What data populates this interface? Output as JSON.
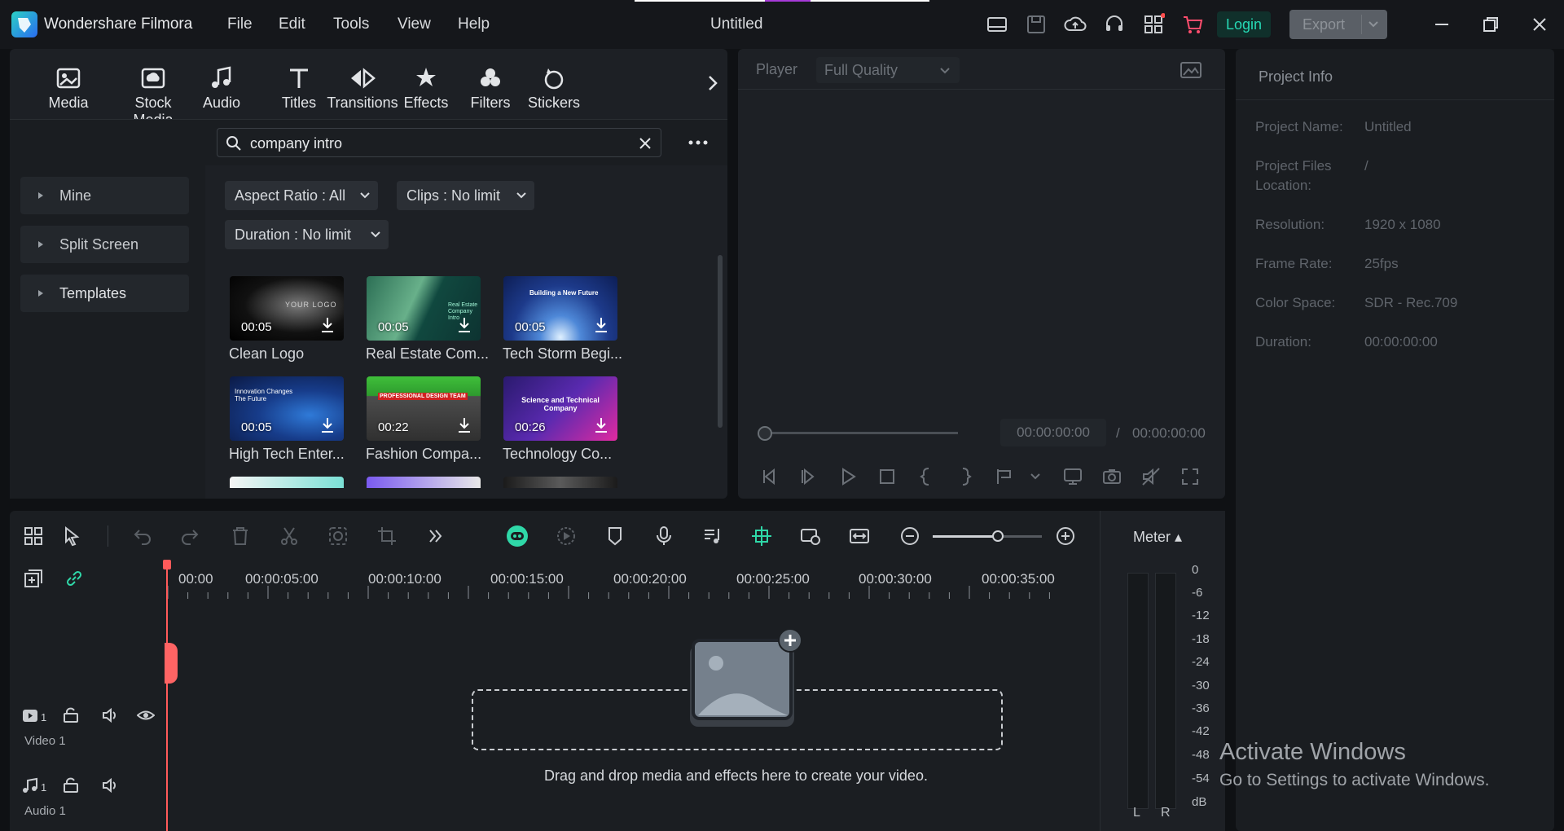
{
  "app": {
    "name": "Wondershare Filmora",
    "doc_title": "Untitled",
    "menu": [
      "File",
      "Edit",
      "Tools",
      "View",
      "Help"
    ],
    "login_label": "Login",
    "export_label": "Export",
    "accent": "#26d9b5"
  },
  "categories": [
    {
      "label": "Media",
      "icon": "media-icon"
    },
    {
      "label": "Stock Media",
      "icon": "stock-media-icon"
    },
    {
      "label": "Audio",
      "icon": "audio-icon"
    },
    {
      "label": "Titles",
      "icon": "titles-icon"
    },
    {
      "label": "Transitions",
      "icon": "transitions-icon"
    },
    {
      "label": "Effects",
      "icon": "effects-icon"
    },
    {
      "label": "Filters",
      "icon": "filters-icon"
    },
    {
      "label": "Stickers",
      "icon": "stickers-icon"
    }
  ],
  "left_nav": [
    "Mine",
    "Split Screen",
    "Templates"
  ],
  "search": {
    "query": "company intro"
  },
  "filters": {
    "aspect": "Aspect Ratio : All",
    "clips": "Clips : No limit",
    "duration": "Duration : No limit"
  },
  "templates": [
    {
      "title": "Clean Logo",
      "duration": "00:05",
      "overlay": "YOUR LOGO"
    },
    {
      "title": "Real Estate Com...",
      "duration": "00:05",
      "overlay": "Real Estate Company Intro"
    },
    {
      "title": "Tech Storm Begi...",
      "duration": "00:05",
      "overlay": "Building a New Future"
    },
    {
      "title": "High Tech Enter...",
      "duration": "00:05",
      "overlay": "Innovation Changes The Future"
    },
    {
      "title": "Fashion Compa...",
      "duration": "00:22",
      "overlay": "PROFESSIONAL DESIGN TEAM"
    },
    {
      "title": "Technology Co...",
      "duration": "00:26",
      "overlay": "Science and Technical Company"
    }
  ],
  "player": {
    "label": "Player",
    "quality": "Full Quality",
    "current_time": "00:00:00:00",
    "separator": "/",
    "total_time": "00:00:00:00"
  },
  "project_info": {
    "title": "Project Info",
    "rows": [
      {
        "key": "Project Name:",
        "value": "Untitled"
      },
      {
        "key": "Project Files Location:",
        "value": "/"
      },
      {
        "key": "Resolution:",
        "value": "1920 x 1080"
      },
      {
        "key": "Frame Rate:",
        "value": "25fps"
      },
      {
        "key": "Color Space:",
        "value": "SDR - Rec.709"
      },
      {
        "key": "Duration:",
        "value": "00:00:00:00"
      }
    ]
  },
  "timeline": {
    "ruler": [
      "00:00",
      "00:00:05:00",
      "00:00:10:00",
      "00:00:15:00",
      "00:00:20:00",
      "00:00:25:00",
      "00:00:30:00",
      "00:00:35:00"
    ],
    "drop_hint": "Drag and drop media and effects here to create your video.",
    "video_track": "Video 1",
    "audio_track": "Audio 1",
    "video_count": "1",
    "audio_count": "1",
    "zoom_level": 0.6
  },
  "meter": {
    "label": "Meter ▴",
    "ticks": [
      "0",
      "-6",
      "-12",
      "-18",
      "-24",
      "-30",
      "-36",
      "-42",
      "-48",
      "-54",
      "dB"
    ],
    "left": "L",
    "right": "R"
  },
  "watermark": {
    "line1": "Activate Windows",
    "line2": "Go to Settings to activate Windows."
  }
}
